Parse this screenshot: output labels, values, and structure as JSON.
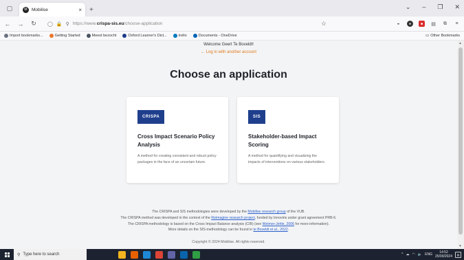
{
  "browser": {
    "tab_title": "Mobilise",
    "tab_favicon": "M",
    "url_prefix": "https://www.",
    "url_domain": "crispa-sis.eu",
    "url_path": "/choose-application",
    "bookmarks": [
      {
        "label": "Import bookmarks...",
        "color": "#6b7280"
      },
      {
        "label": "Getting Started",
        "color": "#e8762c"
      },
      {
        "label": "Meest bezocht",
        "color": "#4b5563"
      },
      {
        "label": "Oxford Learner's Dict...",
        "color": "#1e3a8a"
      },
      {
        "label": "trello",
        "color": "#0079bf"
      },
      {
        "label": "Documents - OneDrive",
        "color": "#0364b8"
      }
    ],
    "other_bookmarks": "Other Bookmarks"
  },
  "page": {
    "welcome": "Welcome Geert Te Boveldt!",
    "login_link": "Log in with another account",
    "heading": "Choose an application",
    "cards": [
      {
        "badge": "CRISPA",
        "title": "Cross Impact Scenario Policy Analysis",
        "description": "A method for creating consistent and robust policy packages in the face of an uncertain future."
      },
      {
        "badge": "SIS",
        "title": "Stakeholder-based Impact Scoring",
        "description": "A method for quantifying and visualizing the impacts of interventions on various stakeholders."
      }
    ],
    "footer": {
      "line1_pre": "The CRISPA and SIS methodologies were developed by the ",
      "line1_link": "Mobilise research group",
      "line1_post": " of the VUB.",
      "line2_pre": "The CRISPA method was developed in the context of the ",
      "line2_link": "Reimagine research project",
      "line2_post": ", funded by Innoviris under grant agreement PRB-6.",
      "line3_pre": "The CRISPA methodology is based on the Cross Impact Balance analysis (CIB) (see ",
      "line3_link": "Weimer-Jehle, 2006",
      "line3_post": " for more information).",
      "line4_pre": "More details on the SIS-methodology can be found in ",
      "line4_link": "te Boveldt et al., 2022",
      "line4_post": "."
    },
    "copyright": "Copyright © 2024 Mobilise. All rights reserved."
  },
  "taskbar": {
    "search_placeholder": "Type here to search",
    "apps": [
      {
        "name": "file-explorer-icon",
        "color": "#f3b51f"
      },
      {
        "name": "firefox-icon",
        "color": "#e66000"
      },
      {
        "name": "edge-icon",
        "color": "#1e88d6"
      },
      {
        "name": "chrome-icon",
        "color": "#db4437"
      },
      {
        "name": "teams-icon",
        "color": "#6264a7"
      },
      {
        "name": "outlook-icon",
        "color": "#0a64ad"
      },
      {
        "name": "maps-icon",
        "color": "#2f9e44"
      }
    ],
    "lang": "ENG",
    "time": "14:52",
    "date": "25/09/2024"
  }
}
